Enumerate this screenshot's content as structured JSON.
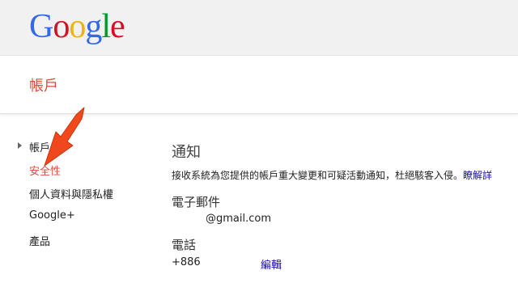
{
  "logo": {
    "letters": [
      "G",
      "o",
      "o",
      "g",
      "l",
      "e"
    ],
    "colors": [
      "#3369e8",
      "#d50f25",
      "#eeb211",
      "#3369e8",
      "#009925",
      "#d50f25"
    ]
  },
  "header": {
    "title": "帳戶"
  },
  "sidebar": {
    "items": [
      {
        "label": "帳戶"
      },
      {
        "label": "安全性"
      },
      {
        "label": "個人資料與隱私權"
      },
      {
        "label": "Google+"
      },
      {
        "label": "產品"
      }
    ]
  },
  "main": {
    "title": "通知",
    "description": "接收系統為您提供的帳戶重大變更和可疑活動通知，杜絕駭客入侵。",
    "learn_more": "瞭解詳",
    "email": {
      "heading": "電子郵件",
      "value": "@gmail.com"
    },
    "phone": {
      "heading": "電話",
      "value": "+886",
      "edit": "編輯"
    }
  },
  "colors": {
    "accent": "#dd4b39",
    "link": "#1a0dab",
    "arrow": "#f1471d"
  }
}
